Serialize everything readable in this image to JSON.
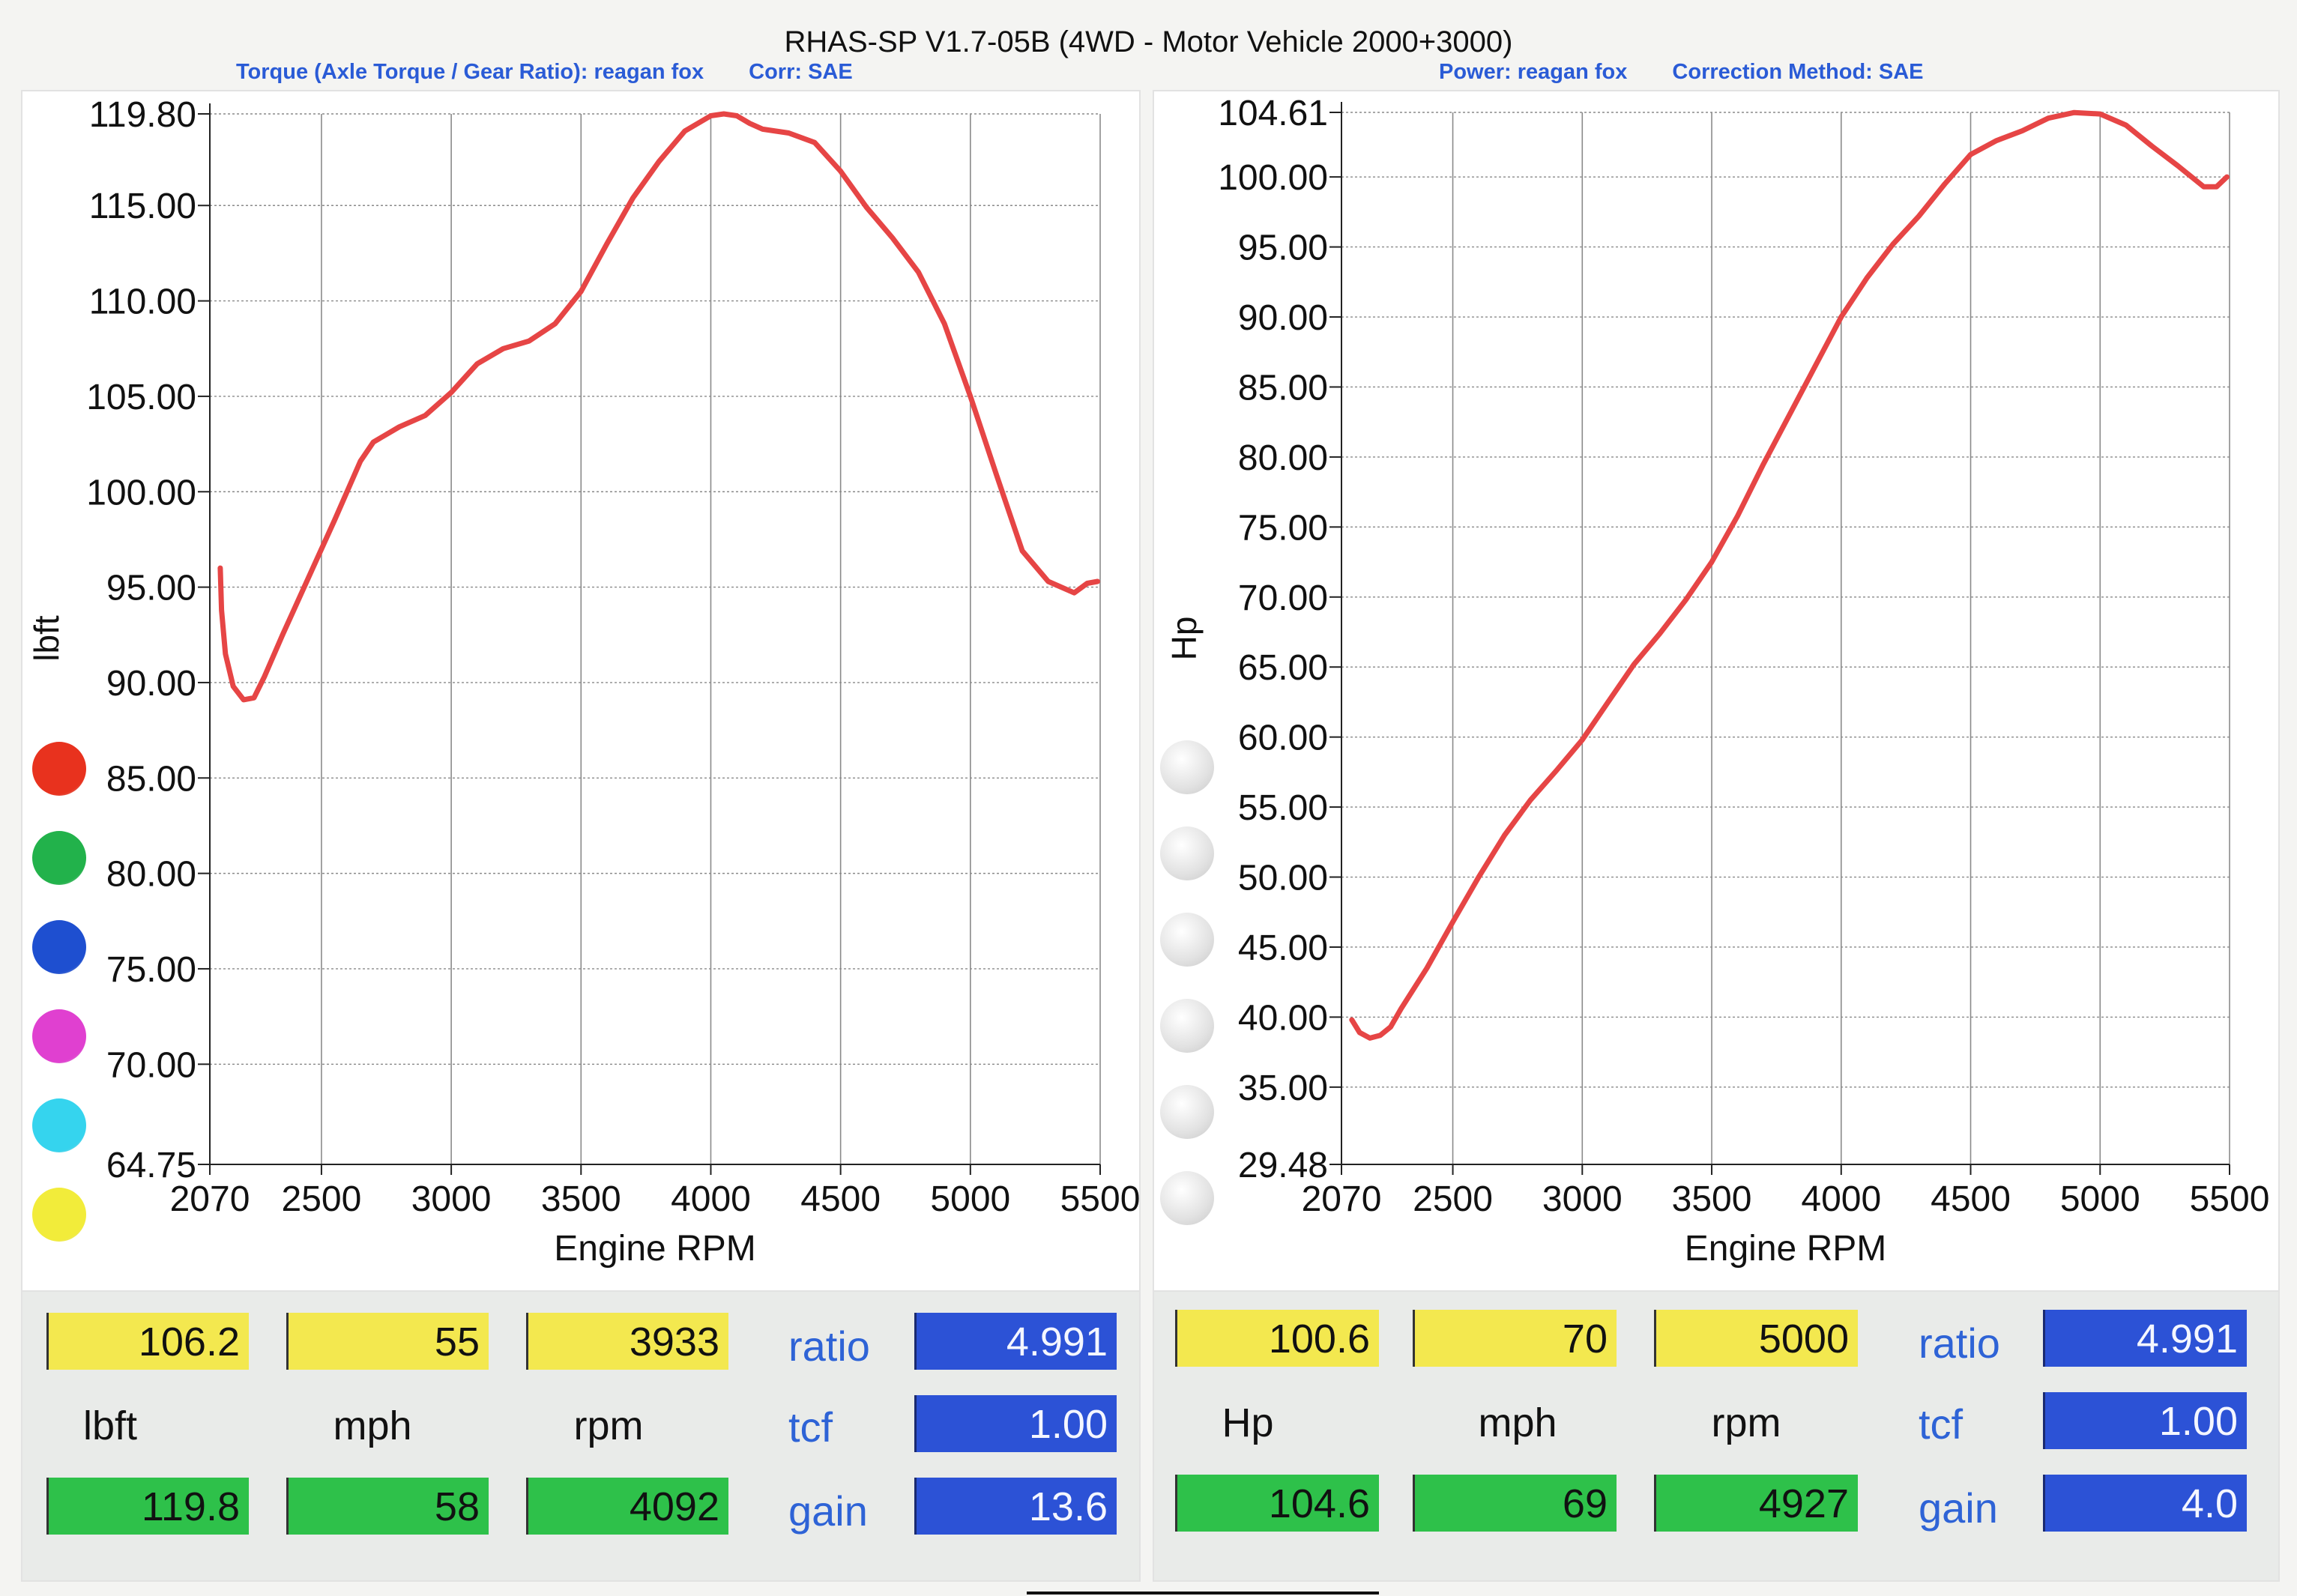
{
  "header": {
    "title": "RHAS-SP V1.7-05B   (4WD - Motor Vehicle 2000+3000)",
    "left_subtitle": [
      "Torque (Axle Torque / Gear Ratio): reagan fox",
      "Corr: SAE"
    ],
    "right_subtitle": [
      "Power: reagan fox",
      "Correction Method: SAE"
    ]
  },
  "colors": {
    "curve": "#e64545",
    "grid": "#8a8a8a",
    "swatches_left": [
      "#e8321e",
      "#22b24b",
      "#1e4fd0",
      "#e040d0",
      "#35d4ee",
      "#f2ec3a"
    ],
    "swatches_right": [
      "#e2e2e2",
      "#e2e2e2",
      "#e2e2e2",
      "#e2e2e2",
      "#e2e2e2",
      "#e2e2e2"
    ],
    "readout_yellow": "#f3e84f",
    "readout_green": "#2ec14a",
    "readout_blue": "#2c52d6"
  },
  "chart_data": [
    {
      "type": "line",
      "xlabel": "Engine RPM",
      "ylabel": "lbft",
      "xlim": [
        2070,
        5500
      ],
      "ylim": [
        64.75,
        119.8
      ],
      "x_ticks": [
        2070,
        2500,
        3000,
        3500,
        4000,
        4500,
        5000,
        5500
      ],
      "x_tick_labels": [
        "2070",
        "2500",
        "3000",
        "3500",
        "4000",
        "4500",
        "5000",
        "5500"
      ],
      "y_ticks": [
        64.75,
        70,
        75,
        80,
        85,
        90,
        95,
        100,
        105,
        110,
        115,
        119.8
      ],
      "y_tick_labels": [
        "64.75",
        "70.00",
        "75.00",
        "80.00",
        "85.00",
        "90.00",
        "95.00",
        "100.00",
        "105.00",
        "110.00",
        "115.00",
        "119.80"
      ],
      "grid": true,
      "series": [
        {
          "x": [
            2110,
            2115,
            2130,
            2160,
            2200,
            2240,
            2280,
            2350,
            2450,
            2550,
            2650,
            2700,
            2800,
            2900,
            3000,
            3100,
            3200,
            3300,
            3400,
            3500,
            3600,
            3700,
            3800,
            3900,
            4000,
            4050,
            4100,
            4150,
            4200,
            4300,
            4400,
            4500,
            4600,
            4700,
            4800,
            4900,
            5000,
            5100,
            5200,
            5300,
            5400,
            5450,
            5490
          ],
          "y": [
            96.0,
            93.8,
            91.5,
            89.8,
            89.1,
            89.2,
            90.3,
            92.5,
            95.5,
            98.5,
            101.6,
            102.6,
            103.4,
            104.0,
            105.2,
            106.7,
            107.5,
            107.9,
            108.8,
            110.5,
            113.0,
            115.4,
            117.3,
            118.9,
            119.7,
            119.8,
            119.7,
            119.3,
            119.0,
            118.8,
            118.3,
            116.8,
            114.9,
            113.3,
            111.5,
            108.8,
            105.0,
            100.9,
            96.9,
            95.3,
            94.7,
            95.2,
            95.3
          ]
        }
      ]
    },
    {
      "type": "line",
      "xlabel": "Engine RPM",
      "ylabel": "Hp",
      "xlim": [
        2070,
        5500
      ],
      "ylim": [
        29.48,
        104.61
      ],
      "x_ticks": [
        2070,
        2500,
        3000,
        3500,
        4000,
        4500,
        5000,
        5500
      ],
      "x_tick_labels": [
        "2070",
        "2500",
        "3000",
        "3500",
        "4000",
        "4500",
        "5000",
        "5500"
      ],
      "y_ticks": [
        29.48,
        35,
        40,
        45,
        50,
        55,
        60,
        65,
        70,
        75,
        80,
        85,
        90,
        95,
        100,
        104.61
      ],
      "y_tick_labels": [
        "29.48",
        "35.00",
        "40.00",
        "45.00",
        "50.00",
        "55.00",
        "60.00",
        "65.00",
        "70.00",
        "75.00",
        "80.00",
        "85.00",
        "90.00",
        "95.00",
        "100.00",
        "104.61"
      ],
      "grid": true,
      "series": [
        {
          "x": [
            2110,
            2140,
            2180,
            2220,
            2260,
            2300,
            2400,
            2500,
            2600,
            2700,
            2800,
            2900,
            3000,
            3100,
            3200,
            3300,
            3400,
            3500,
            3600,
            3700,
            3800,
            3900,
            4000,
            4100,
            4200,
            4300,
            4400,
            4500,
            4600,
            4700,
            4800,
            4900,
            5000,
            5100,
            5200,
            5300,
            5400,
            5450,
            5490
          ],
          "y": [
            39.8,
            38.9,
            38.5,
            38.7,
            39.3,
            40.6,
            43.5,
            46.8,
            50.0,
            53.0,
            55.5,
            57.6,
            59.8,
            62.5,
            65.2,
            67.4,
            69.8,
            72.5,
            75.8,
            79.5,
            83.0,
            86.5,
            90.0,
            92.8,
            95.2,
            97.2,
            99.5,
            101.6,
            102.6,
            103.3,
            104.2,
            104.6,
            104.5,
            103.7,
            102.2,
            100.8,
            99.3,
            99.3,
            100.0
          ]
        }
      ]
    }
  ],
  "readout_left": {
    "row1": [
      "106.2",
      "55",
      "3933"
    ],
    "units": [
      "lbft",
      "mph",
      "rpm"
    ],
    "row2": [
      "119.8",
      "58",
      "4092"
    ],
    "labels": [
      "ratio",
      "tcf",
      "gain"
    ],
    "values": [
      "4.991",
      "1.00",
      "13.6"
    ]
  },
  "readout_right": {
    "row1": [
      "100.6",
      "70",
      "5000"
    ],
    "units": [
      "Hp",
      "mph",
      "rpm"
    ],
    "row2": [
      "104.6",
      "69",
      "4927"
    ],
    "labels": [
      "ratio",
      "tcf",
      "gain"
    ],
    "values": [
      "4.991",
      "1.00",
      "4.0"
    ]
  }
}
